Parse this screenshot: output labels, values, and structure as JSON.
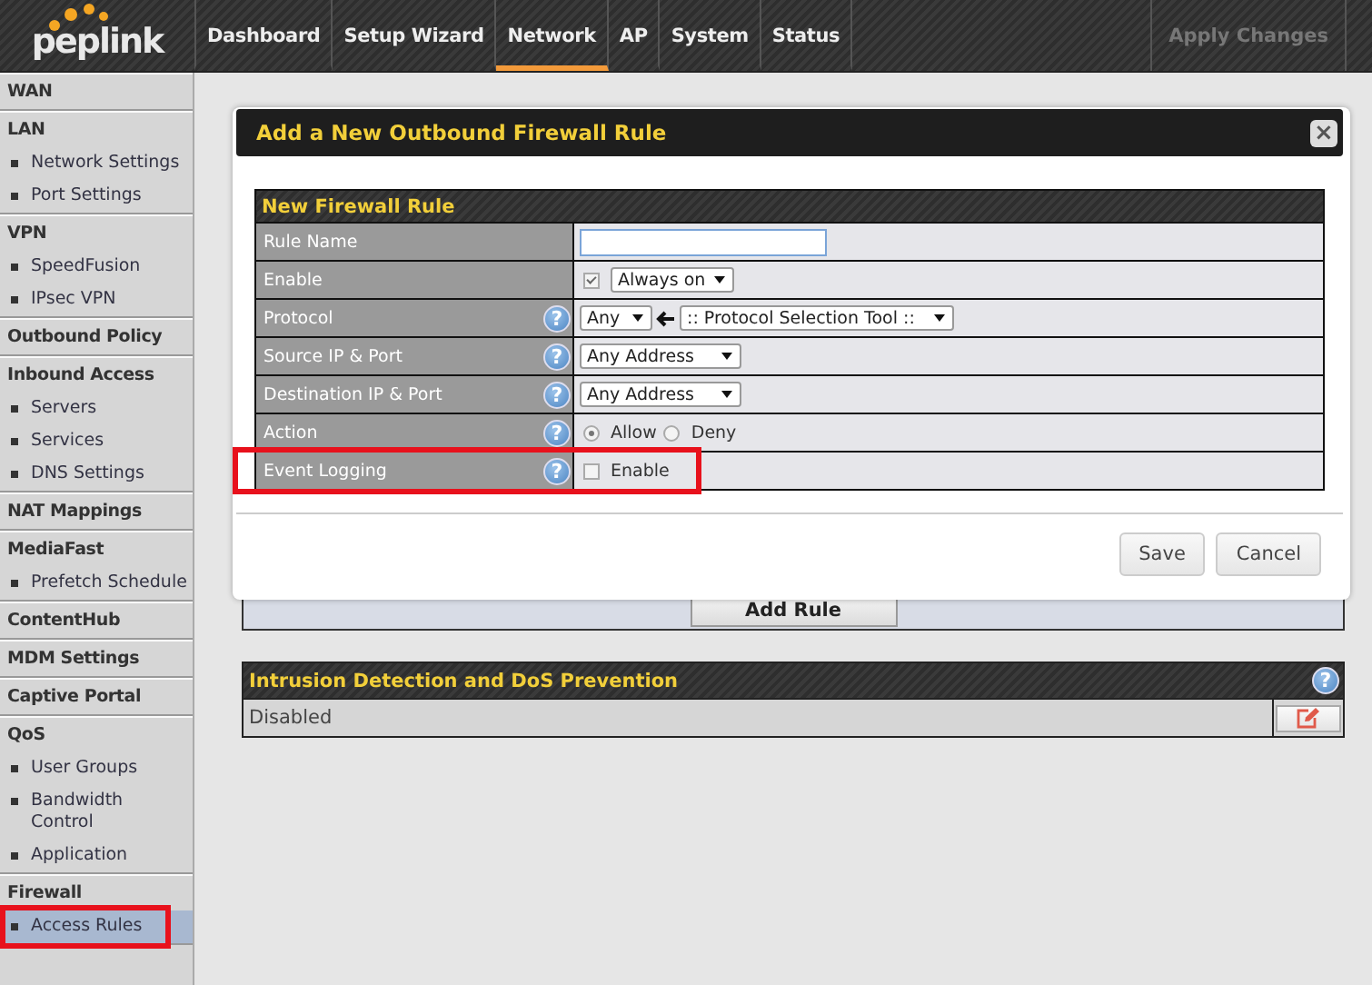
{
  "nav": {
    "logo": "peplink",
    "tabs": [
      {
        "label": "Dashboard",
        "selected": false
      },
      {
        "label": "Setup Wizard",
        "selected": false
      },
      {
        "label": "Network",
        "selected": true
      },
      {
        "label": "AP",
        "selected": false
      },
      {
        "label": "System",
        "selected": false
      },
      {
        "label": "Status",
        "selected": false
      }
    ],
    "apply": {
      "label": "Apply Changes",
      "disabled": true
    }
  },
  "sidebar": {
    "sections": [
      {
        "title": "WAN"
      },
      {
        "title": "LAN",
        "children": [
          {
            "label": "Network Settings",
            "selected": false,
            "highlighted": false
          },
          {
            "label": "Port Settings",
            "selected": false,
            "highlighted": false
          }
        ]
      },
      {
        "title": "VPN",
        "children": [
          {
            "label": "SpeedFusion",
            "selected": false,
            "highlighted": false
          },
          {
            "label": "IPsec VPN",
            "selected": false,
            "highlighted": false
          }
        ]
      },
      {
        "title": "Outbound Policy"
      },
      {
        "title": "Inbound Access",
        "children": [
          {
            "label": "Servers",
            "selected": false,
            "highlighted": false
          },
          {
            "label": "Services",
            "selected": false,
            "highlighted": false
          },
          {
            "label": "DNS Settings",
            "selected": false,
            "highlighted": false
          }
        ]
      },
      {
        "title": "NAT Mappings"
      },
      {
        "title": "MediaFast",
        "children": [
          {
            "label": "Prefetch Schedule",
            "selected": false,
            "highlighted": false
          }
        ]
      },
      {
        "title": "ContentHub"
      },
      {
        "title": "MDM Settings"
      },
      {
        "title": "Captive Portal"
      },
      {
        "title": "QoS",
        "children": [
          {
            "label": "User Groups",
            "selected": false,
            "highlighted": false
          },
          {
            "label": "Bandwidth Control",
            "selected": false,
            "highlighted": false
          },
          {
            "label": "Application",
            "selected": false,
            "highlighted": false
          }
        ]
      },
      {
        "title": "Firewall",
        "children": [
          {
            "label": "Access Rules",
            "selected": true,
            "highlighted": true
          }
        ]
      }
    ]
  },
  "modal": {
    "title": "Add a New Outbound Firewall Rule",
    "close": "×",
    "form": {
      "title": "New Firewall Rule",
      "rows": [
        {
          "kind": "text",
          "label": "Rule Name",
          "highlighted": false
        },
        {
          "kind": "checkselect",
          "label": "Enable",
          "checked": true,
          "select": "Always on",
          "highlighted": false
        },
        {
          "kind": "protocol",
          "label": "Protocol",
          "help": "?",
          "select": "Any",
          "tool": ":: Protocol Selection Tool ::",
          "highlighted": false
        },
        {
          "kind": "select",
          "label": "Source IP & Port",
          "help": "?",
          "select": "Any Address",
          "highlighted": false
        },
        {
          "kind": "select",
          "label": "Destination IP & Port",
          "help": "?",
          "select": "Any Address",
          "highlighted": false
        },
        {
          "kind": "radio",
          "label": "Action",
          "help": "?",
          "options": [
            {
              "label": "Allow",
              "selected": true
            },
            {
              "label": "Deny",
              "selected": false
            }
          ],
          "highlighted": false
        },
        {
          "kind": "checkbox",
          "label": "Event Logging",
          "help": "?",
          "checked": false,
          "option": "Enable",
          "highlighted": true
        }
      ]
    },
    "buttons": [
      "Save",
      "Cancel"
    ]
  },
  "add_rule": "Add Rule",
  "ids_panel": {
    "title": "Intrusion Detection and DoS Prevention",
    "help": "?",
    "value": "Disabled"
  }
}
